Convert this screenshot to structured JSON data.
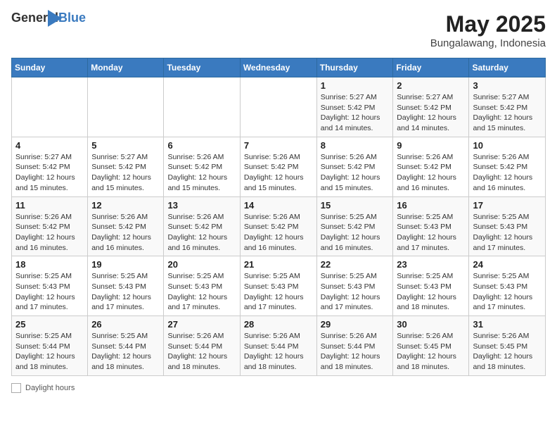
{
  "header": {
    "logo_general": "General",
    "logo_blue": "Blue",
    "title": "May 2025",
    "subtitle": "Bungalawang, Indonesia"
  },
  "calendar": {
    "weekdays": [
      "Sunday",
      "Monday",
      "Tuesday",
      "Wednesday",
      "Thursday",
      "Friday",
      "Saturday"
    ],
    "weeks": [
      [
        {
          "day": "",
          "info": ""
        },
        {
          "day": "",
          "info": ""
        },
        {
          "day": "",
          "info": ""
        },
        {
          "day": "",
          "info": ""
        },
        {
          "day": "1",
          "info": "Sunrise: 5:27 AM\nSunset: 5:42 PM\nDaylight: 12 hours and 14 minutes."
        },
        {
          "day": "2",
          "info": "Sunrise: 5:27 AM\nSunset: 5:42 PM\nDaylight: 12 hours and 14 minutes."
        },
        {
          "day": "3",
          "info": "Sunrise: 5:27 AM\nSunset: 5:42 PM\nDaylight: 12 hours and 15 minutes."
        }
      ],
      [
        {
          "day": "4",
          "info": "Sunrise: 5:27 AM\nSunset: 5:42 PM\nDaylight: 12 hours and 15 minutes."
        },
        {
          "day": "5",
          "info": "Sunrise: 5:27 AM\nSunset: 5:42 PM\nDaylight: 12 hours and 15 minutes."
        },
        {
          "day": "6",
          "info": "Sunrise: 5:26 AM\nSunset: 5:42 PM\nDaylight: 12 hours and 15 minutes."
        },
        {
          "day": "7",
          "info": "Sunrise: 5:26 AM\nSunset: 5:42 PM\nDaylight: 12 hours and 15 minutes."
        },
        {
          "day": "8",
          "info": "Sunrise: 5:26 AM\nSunset: 5:42 PM\nDaylight: 12 hours and 15 minutes."
        },
        {
          "day": "9",
          "info": "Sunrise: 5:26 AM\nSunset: 5:42 PM\nDaylight: 12 hours and 16 minutes."
        },
        {
          "day": "10",
          "info": "Sunrise: 5:26 AM\nSunset: 5:42 PM\nDaylight: 12 hours and 16 minutes."
        }
      ],
      [
        {
          "day": "11",
          "info": "Sunrise: 5:26 AM\nSunset: 5:42 PM\nDaylight: 12 hours and 16 minutes."
        },
        {
          "day": "12",
          "info": "Sunrise: 5:26 AM\nSunset: 5:42 PM\nDaylight: 12 hours and 16 minutes."
        },
        {
          "day": "13",
          "info": "Sunrise: 5:26 AM\nSunset: 5:42 PM\nDaylight: 12 hours and 16 minutes."
        },
        {
          "day": "14",
          "info": "Sunrise: 5:26 AM\nSunset: 5:42 PM\nDaylight: 12 hours and 16 minutes."
        },
        {
          "day": "15",
          "info": "Sunrise: 5:25 AM\nSunset: 5:42 PM\nDaylight: 12 hours and 16 minutes."
        },
        {
          "day": "16",
          "info": "Sunrise: 5:25 AM\nSunset: 5:43 PM\nDaylight: 12 hours and 17 minutes."
        },
        {
          "day": "17",
          "info": "Sunrise: 5:25 AM\nSunset: 5:43 PM\nDaylight: 12 hours and 17 minutes."
        }
      ],
      [
        {
          "day": "18",
          "info": "Sunrise: 5:25 AM\nSunset: 5:43 PM\nDaylight: 12 hours and 17 minutes."
        },
        {
          "day": "19",
          "info": "Sunrise: 5:25 AM\nSunset: 5:43 PM\nDaylight: 12 hours and 17 minutes."
        },
        {
          "day": "20",
          "info": "Sunrise: 5:25 AM\nSunset: 5:43 PM\nDaylight: 12 hours and 17 minutes."
        },
        {
          "day": "21",
          "info": "Sunrise: 5:25 AM\nSunset: 5:43 PM\nDaylight: 12 hours and 17 minutes."
        },
        {
          "day": "22",
          "info": "Sunrise: 5:25 AM\nSunset: 5:43 PM\nDaylight: 12 hours and 17 minutes."
        },
        {
          "day": "23",
          "info": "Sunrise: 5:25 AM\nSunset: 5:43 PM\nDaylight: 12 hours and 18 minutes."
        },
        {
          "day": "24",
          "info": "Sunrise: 5:25 AM\nSunset: 5:43 PM\nDaylight: 12 hours and 17 minutes."
        }
      ],
      [
        {
          "day": "25",
          "info": "Sunrise: 5:25 AM\nSunset: 5:44 PM\nDaylight: 12 hours and 18 minutes."
        },
        {
          "day": "26",
          "info": "Sunrise: 5:25 AM\nSunset: 5:44 PM\nDaylight: 12 hours and 18 minutes."
        },
        {
          "day": "27",
          "info": "Sunrise: 5:26 AM\nSunset: 5:44 PM\nDaylight: 12 hours and 18 minutes."
        },
        {
          "day": "28",
          "info": "Sunrise: 5:26 AM\nSunset: 5:44 PM\nDaylight: 12 hours and 18 minutes."
        },
        {
          "day": "29",
          "info": "Sunrise: 5:26 AM\nSunset: 5:44 PM\nDaylight: 12 hours and 18 minutes."
        },
        {
          "day": "30",
          "info": "Sunrise: 5:26 AM\nSunset: 5:45 PM\nDaylight: 12 hours and 18 minutes."
        },
        {
          "day": "31",
          "info": "Sunrise: 5:26 AM\nSunset: 5:45 PM\nDaylight: 12 hours and 18 minutes."
        }
      ]
    ]
  },
  "footer": {
    "daylight_label": "Daylight hours"
  }
}
